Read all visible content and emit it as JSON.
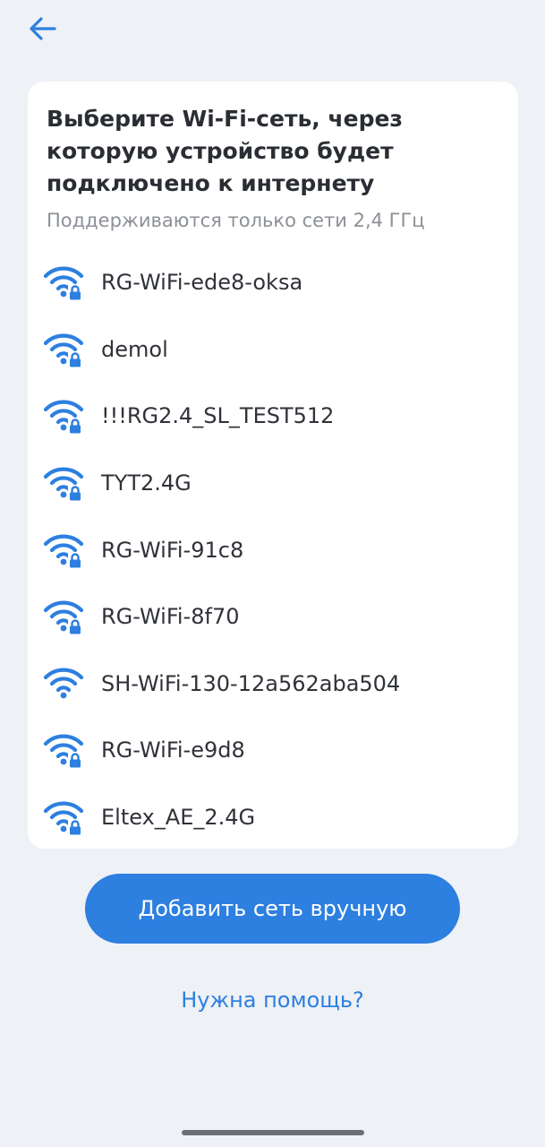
{
  "header": {
    "back_icon": "arrow-left-icon"
  },
  "card": {
    "title": "Выберите Wi-Fi-сеть, через которую устройство будет подключено к интернету",
    "subtitle": "Поддерживаются только сети 2,4 ГГц"
  },
  "networks": [
    {
      "name": "RG-WiFi-ede8-oksa",
      "icon": "wifi-lock-icon",
      "secured": true
    },
    {
      "name": "demol",
      "icon": "wifi-lock-icon",
      "secured": true
    },
    {
      "name": "!!!RG2.4_SL_TEST512",
      "icon": "wifi-lock-icon",
      "secured": true
    },
    {
      "name": "TYT2.4G",
      "icon": "wifi-lock-icon",
      "secured": true
    },
    {
      "name": "RG-WiFi-91c8",
      "icon": "wifi-lock-icon",
      "secured": true
    },
    {
      "name": "RG-WiFi-8f70",
      "icon": "wifi-lock-icon",
      "secured": true
    },
    {
      "name": "SH-WiFi-130-12a562aba504",
      "icon": "wifi-icon",
      "secured": false
    },
    {
      "name": "RG-WiFi-e9d8",
      "icon": "wifi-lock-icon",
      "secured": true
    },
    {
      "name": "Eltex_AE_2.4G",
      "icon": "wifi-lock-icon",
      "secured": true
    }
  ],
  "actions": {
    "add_network_label": "Добавить сеть вручную",
    "help_label": "Нужна помощь?"
  },
  "colors": {
    "accent": "#2d7fe0",
    "background": "#eef1f5",
    "card": "#ffffff",
    "text": "#2f3238",
    "muted": "#8c9097"
  }
}
